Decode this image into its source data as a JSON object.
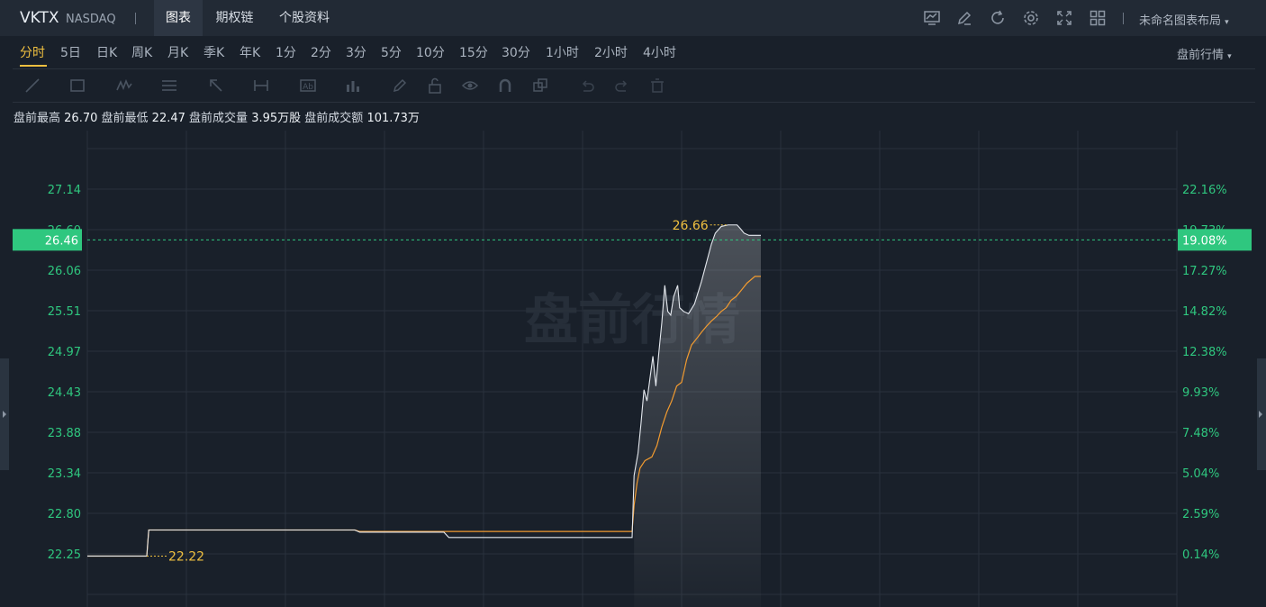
{
  "header": {
    "symbol": "VKTX",
    "exchange": "NASDAQ",
    "tabs": [
      {
        "label": "图表",
        "active": true
      },
      {
        "label": "期权链",
        "active": false
      },
      {
        "label": "个股资料",
        "active": false
      }
    ],
    "toolbar_icons": [
      "chart-screen-icon",
      "edit-icon",
      "refresh-icon",
      "settings-icon",
      "fullscreen-icon",
      "grid-layout-icon"
    ],
    "layout_label": "未命名图表布局"
  },
  "periods": {
    "items": [
      "分时",
      "5日",
      "日K",
      "周K",
      "月K",
      "季K",
      "年K",
      "1分",
      "2分",
      "3分",
      "5分",
      "10分",
      "15分",
      "30分",
      "1小时",
      "2小时",
      "4小时"
    ],
    "active": "分时",
    "session_label": "盘前行情"
  },
  "drawing_tools": [
    "line-tool-icon",
    "rectangle-tool-icon",
    "pattern-tool-icon",
    "fib-tool-icon",
    "arrow-tool-icon",
    "measure-tool-icon",
    "text-tool-icon",
    "indicator-icon",
    "pencil-icon",
    "unlock-icon",
    "eye-icon",
    "magnet-icon",
    "copy-icon",
    "undo-icon",
    "redo-icon",
    "trash-icon"
  ],
  "stats": {
    "high_label": "盘前最高",
    "high": "26.70",
    "low_label": "盘前最低",
    "low": "22.47",
    "volume_label": "盘前成交量",
    "volume": "3.95万股",
    "amount_label": "盘前成交额",
    "amount": "101.73万"
  },
  "colors": {
    "accent": "#f0c040",
    "up": "#2fc77f",
    "price_line": "#e5e9ef",
    "avg_line": "#f29b30"
  },
  "chart_data": {
    "type": "line",
    "watermark": "盘前行情",
    "price_ticks": [
      "27.14",
      "26.60",
      "26.06",
      "25.51",
      "24.97",
      "24.43",
      "23.88",
      "23.34",
      "22.80",
      "22.25"
    ],
    "percent_ticks": [
      "22.16%",
      "19.73%",
      "17.27%",
      "14.82%",
      "12.38%",
      "9.93%",
      "7.48%",
      "5.04%",
      "2.59%",
      "0.14%"
    ],
    "current_price": "26.46",
    "current_percent": "19.08%",
    "max_label": "26.66",
    "min_label": "22.22",
    "ylim": [
      22.0,
      27.5
    ],
    "x_range": [
      0,
      110
    ],
    "series": [
      {
        "key": "price",
        "x": [
          0,
          6,
          6.2,
          10,
          20,
          27,
          27.5,
          36,
          36.5,
          40,
          41,
          55,
          55.2,
          55.6,
          55.9,
          56.2,
          56.5,
          56.8,
          57.1,
          57.4,
          57.7,
          58,
          58.3,
          58.6,
          58.9,
          59.2,
          59.6,
          59.8,
          60.2,
          60.7,
          61.3,
          62,
          62.6,
          63,
          63.4,
          64,
          64.7,
          65.2,
          65.6,
          66,
          66.3,
          66.8,
          67.1,
          67.4,
          68
        ],
        "y": [
          22.22,
          22.22,
          22.57,
          22.57,
          22.57,
          22.57,
          22.54,
          22.54,
          22.47,
          22.47,
          22.47,
          22.47,
          23.3,
          23.6,
          24.0,
          24.45,
          24.3,
          24.6,
          24.9,
          24.5,
          24.95,
          25.35,
          25.85,
          25.5,
          25.45,
          25.7,
          25.85,
          25.55,
          25.5,
          25.47,
          25.6,
          25.9,
          26.2,
          26.4,
          26.55,
          26.64,
          26.66,
          26.66,
          26.66,
          26.6,
          26.55,
          26.52,
          26.52,
          26.52,
          26.52
        ]
      },
      {
        "key": "average",
        "x": [
          0,
          6,
          6.2,
          20,
          27,
          27.5,
          55,
          55.2,
          55.5,
          55.8,
          56.3,
          57,
          57.5,
          58,
          58.5,
          59,
          59.5,
          60,
          60.5,
          61,
          61.6,
          62,
          62.5,
          63,
          63.5,
          64,
          64.5,
          65,
          65.5,
          66,
          66.6,
          67.4,
          68
        ],
        "y": [
          22.22,
          22.22,
          22.57,
          22.57,
          22.57,
          22.55,
          22.55,
          22.9,
          23.2,
          23.4,
          23.5,
          23.55,
          23.7,
          23.95,
          24.15,
          24.3,
          24.5,
          24.55,
          24.85,
          25.05,
          25.15,
          25.22,
          25.3,
          25.37,
          25.43,
          25.5,
          25.55,
          25.65,
          25.7,
          25.78,
          25.88,
          25.97,
          25.97
        ]
      }
    ]
  }
}
